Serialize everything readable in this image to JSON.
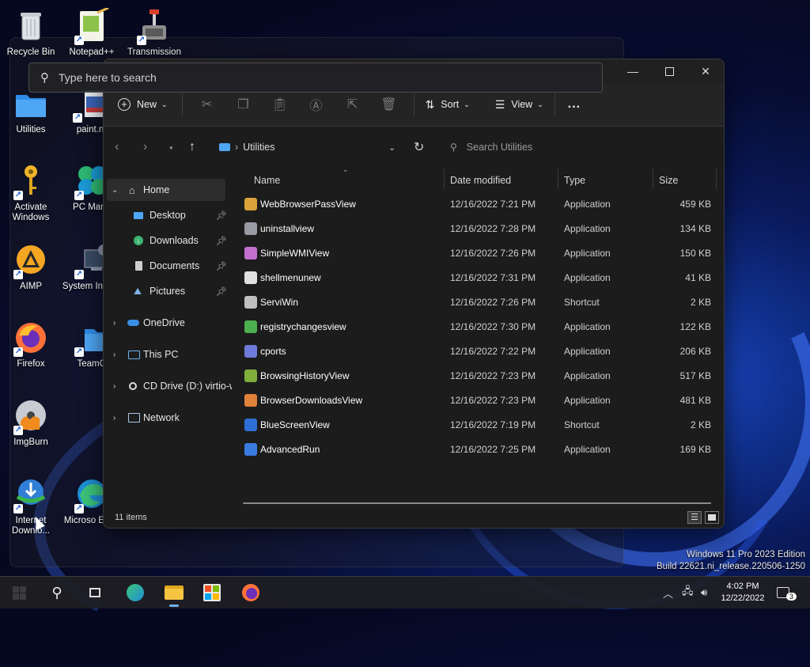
{
  "desktop": {
    "icons": [
      {
        "label": "Recycle Bin"
      },
      {
        "label": "Notepad++"
      },
      {
        "label": "Transmission"
      },
      {
        "label": "Utilities"
      },
      {
        "label": "paint.n"
      },
      {
        "label": "Activate Windows"
      },
      {
        "label": "PC Mana"
      },
      {
        "label": "AIMP"
      },
      {
        "label": "System Inform"
      },
      {
        "label": "Firefox"
      },
      {
        "label": "TeamO"
      },
      {
        "label": "ImgBurn"
      },
      {
        "label": "Internet Downlo..."
      },
      {
        "label": "Microso Edge"
      }
    ],
    "watermark_line1": "Windows 11 Pro 2023 Edition",
    "watermark_line2": "Build 22621.ni_release.220506-1250"
  },
  "search_popup": {
    "placeholder": "Type here to search"
  },
  "explorer": {
    "toolbar": {
      "new_label": "New",
      "sort_label": "Sort",
      "view_label": "View",
      "more_label": "..."
    },
    "address": {
      "folder": "Utilities",
      "search_placeholder": "Search Utilities"
    },
    "sidebar": {
      "home": "Home",
      "quick": [
        {
          "label": "Desktop"
        },
        {
          "label": "Downloads"
        },
        {
          "label": "Documents"
        },
        {
          "label": "Pictures"
        }
      ],
      "onedrive": "OneDrive",
      "thispc": "This PC",
      "cddrive": "CD Drive (D:) virtio-w",
      "network": "Network"
    },
    "columns": {
      "name": "Name",
      "date": "Date modified",
      "type": "Type",
      "size": "Size"
    },
    "files": [
      {
        "name": "WebBrowserPassView",
        "date": "12/16/2022 7:21 PM",
        "type": "Application",
        "size": "459 KB",
        "color": "#d9a23a"
      },
      {
        "name": "uninstallview",
        "date": "12/16/2022 7:28 PM",
        "type": "Application",
        "size": "134 KB",
        "color": "#9a9aa6"
      },
      {
        "name": "SimpleWMIView",
        "date": "12/16/2022 7:26 PM",
        "type": "Application",
        "size": "150 KB",
        "color": "#c46fd0"
      },
      {
        "name": "shellmenunew",
        "date": "12/16/2022 7:31 PM",
        "type": "Application",
        "size": "41 KB",
        "color": "#e0e0e0"
      },
      {
        "name": "ServiWin",
        "date": "12/16/2022 7:26 PM",
        "type": "Shortcut",
        "size": "2 KB",
        "color": "#bfbfbf"
      },
      {
        "name": "registrychangesview",
        "date": "12/16/2022 7:30 PM",
        "type": "Application",
        "size": "122 KB",
        "color": "#4caf50"
      },
      {
        "name": "cports",
        "date": "12/16/2022 7:22 PM",
        "type": "Application",
        "size": "206 KB",
        "color": "#6f7bd9"
      },
      {
        "name": "BrowsingHistoryView",
        "date": "12/16/2022 7:23 PM",
        "type": "Application",
        "size": "517 KB",
        "color": "#7fae3a"
      },
      {
        "name": "BrowserDownloadsView",
        "date": "12/16/2022 7:23 PM",
        "type": "Application",
        "size": "481 KB",
        "color": "#e0813a"
      },
      {
        "name": "BlueScreenView",
        "date": "12/16/2022 7:19 PM",
        "type": "Shortcut",
        "size": "2 KB",
        "color": "#2e6fd6"
      },
      {
        "name": "AdvancedRun",
        "date": "12/16/2022 7:25 PM",
        "type": "Application",
        "size": "169 KB",
        "color": "#3a7be0"
      }
    ],
    "status": "11 items"
  },
  "taskbar": {
    "clock_time": "4:02 PM",
    "clock_date": "12/22/2022",
    "notification_count": "3"
  }
}
